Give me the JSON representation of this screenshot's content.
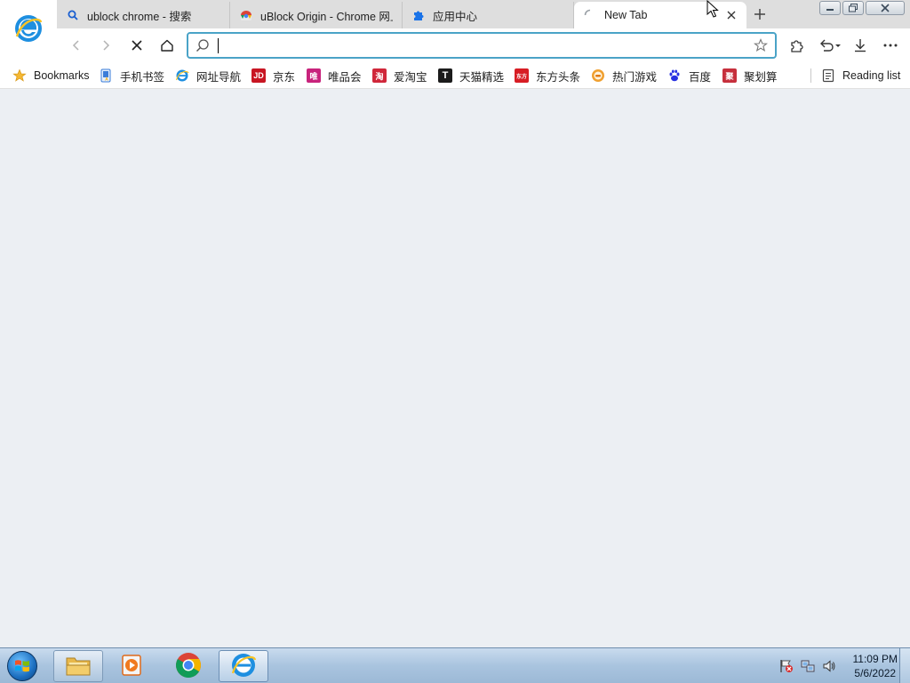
{
  "tabs": [
    {
      "title": "ublock chrome - 搜索",
      "icon": "search-icon"
    },
    {
      "title": "uBlock Origin - Chrome 网上应用店",
      "icon": "chrome-web-store-icon"
    },
    {
      "title": "应用中心",
      "icon": "puzzle-icon"
    },
    {
      "title": "New Tab",
      "icon": "loading-spinner-icon",
      "active": true
    }
  ],
  "toolbar": {
    "omnibox_value": "",
    "omnibox_placeholder": ""
  },
  "bookmarks": [
    {
      "label": "Bookmarks",
      "icon": "star-icon"
    },
    {
      "label": "手机书签",
      "icon": "mobile-bookmark-icon"
    },
    {
      "label": "网址导航",
      "icon": "ie-e-icon"
    },
    {
      "label": "京东",
      "icon": "jd-icon",
      "glyph": "JD",
      "color": "#c81623"
    },
    {
      "label": "唯品会",
      "icon": "vip-icon",
      "glyph": "唯",
      "color": "#c8237c"
    },
    {
      "label": "爱淘宝",
      "icon": "aitaobao-icon",
      "glyph": "淘",
      "color": "#d0273a"
    },
    {
      "label": "天猫精选",
      "icon": "tmall-icon",
      "glyph": "T",
      "color": "#1b1b1b"
    },
    {
      "label": "东方头条",
      "icon": "dftt-icon",
      "glyph": "东方",
      "color": "#d71d24"
    },
    {
      "label": "热门游戏",
      "icon": "game-icon",
      "glyph": "",
      "color": "#f0a030"
    },
    {
      "label": "百度",
      "icon": "baidu-paw-icon",
      "glyph": "",
      "color": "#2932e1"
    },
    {
      "label": "聚划算",
      "icon": "juhuasuan-icon",
      "glyph": "聚",
      "color": "#c62f3c"
    }
  ],
  "reading_list": {
    "label": "Reading list",
    "icon": "reading-list-icon"
  },
  "taskbar": {
    "time": "11:09 PM",
    "date": "5/6/2022"
  }
}
